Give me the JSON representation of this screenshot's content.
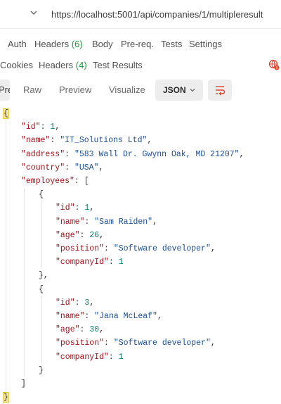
{
  "url_bar": {
    "url": "https://localhost:5001/api/companies/1/multipleresult",
    "dropdown_icon": "chevron-down-icon"
  },
  "request_tabs": [
    {
      "label": "Auth"
    },
    {
      "label": "Headers",
      "count": "(6)"
    },
    {
      "label": "Body"
    },
    {
      "label": "Pre-req."
    },
    {
      "label": "Tests"
    },
    {
      "label": "Settings"
    }
  ],
  "response_tabs": [
    {
      "label": "Cookies"
    },
    {
      "label": "Headers",
      "count": "(4)"
    },
    {
      "label": "Test Results"
    }
  ],
  "response_status_icon": "globe-alert-icon",
  "format_bar": {
    "pretty": "Pretty",
    "raw": "Raw",
    "preview": "Preview",
    "visualize": "Visualize",
    "language": "JSON",
    "wrap_icon": "wrap-lines-icon"
  },
  "colors": {
    "key": "#a1121b",
    "string": "#1c4f94",
    "number": "#0a7d6d",
    "count": "#1f9a3a",
    "brace_highlight": "#f7e79e"
  },
  "json_lines": [
    {
      "parts": [
        [
          "p",
          "{"
        ]
      ]
    },
    {
      "parts": [
        [
          "k",
          "\"id\""
        ],
        [
          "p",
          ": "
        ],
        [
          "n",
          "1"
        ],
        [
          "p",
          ","
        ]
      ]
    },
    {
      "parts": [
        [
          "k",
          "\"name\""
        ],
        [
          "p",
          ": "
        ],
        [
          "s",
          "\"IT_Solutions Ltd\""
        ],
        [
          "p",
          ","
        ]
      ]
    },
    {
      "parts": [
        [
          "k",
          "\"address\""
        ],
        [
          "p",
          ": "
        ],
        [
          "s",
          "\"583 Wall Dr. Gwynn Oak, MD 21207\""
        ],
        [
          "p",
          ","
        ]
      ]
    },
    {
      "parts": [
        [
          "k",
          "\"country\""
        ],
        [
          "p",
          ": "
        ],
        [
          "s",
          "\"USA\""
        ],
        [
          "p",
          ","
        ]
      ]
    },
    {
      "parts": [
        [
          "k",
          "\"employees\""
        ],
        [
          "p",
          ": ["
        ]
      ]
    },
    {
      "parts": [
        [
          "p",
          "{"
        ]
      ]
    },
    {
      "parts": [
        [
          "k",
          "\"id\""
        ],
        [
          "p",
          ": "
        ],
        [
          "n",
          "1"
        ],
        [
          "p",
          ","
        ]
      ]
    },
    {
      "parts": [
        [
          "k",
          "\"name\""
        ],
        [
          "p",
          ": "
        ],
        [
          "s",
          "\"Sam Raiden\""
        ],
        [
          "p",
          ","
        ]
      ]
    },
    {
      "parts": [
        [
          "k",
          "\"age\""
        ],
        [
          "p",
          ": "
        ],
        [
          "n",
          "26"
        ],
        [
          "p",
          ","
        ]
      ]
    },
    {
      "parts": [
        [
          "k",
          "\"position\""
        ],
        [
          "p",
          ": "
        ],
        [
          "s",
          "\"Software developer\""
        ],
        [
          "p",
          ","
        ]
      ]
    },
    {
      "parts": [
        [
          "k",
          "\"companyId\""
        ],
        [
          "p",
          ": "
        ],
        [
          "n",
          "1"
        ]
      ]
    },
    {
      "parts": [
        [
          "p",
          "},"
        ]
      ]
    },
    {
      "parts": [
        [
          "p",
          "{"
        ]
      ]
    },
    {
      "parts": [
        [
          "k",
          "\"id\""
        ],
        [
          "p",
          ": "
        ],
        [
          "n",
          "3"
        ],
        [
          "p",
          ","
        ]
      ]
    },
    {
      "parts": [
        [
          "k",
          "\"name\""
        ],
        [
          "p",
          ": "
        ],
        [
          "s",
          "\"Jana McLeaf\""
        ],
        [
          "p",
          ","
        ]
      ]
    },
    {
      "parts": [
        [
          "k",
          "\"age\""
        ],
        [
          "p",
          ": "
        ],
        [
          "n",
          "30"
        ],
        [
          "p",
          ","
        ]
      ]
    },
    {
      "parts": [
        [
          "k",
          "\"position\""
        ],
        [
          "p",
          ": "
        ],
        [
          "s",
          "\"Software developer\""
        ],
        [
          "p",
          ","
        ]
      ]
    },
    {
      "parts": [
        [
          "k",
          "\"companyId\""
        ],
        [
          "p",
          ": "
        ],
        [
          "n",
          "1"
        ]
      ]
    },
    {
      "parts": [
        [
          "p",
          "}"
        ]
      ]
    },
    {
      "parts": [
        [
          "p",
          "]"
        ]
      ]
    },
    {
      "parts": [
        [
          "p",
          "}"
        ]
      ]
    }
  ]
}
